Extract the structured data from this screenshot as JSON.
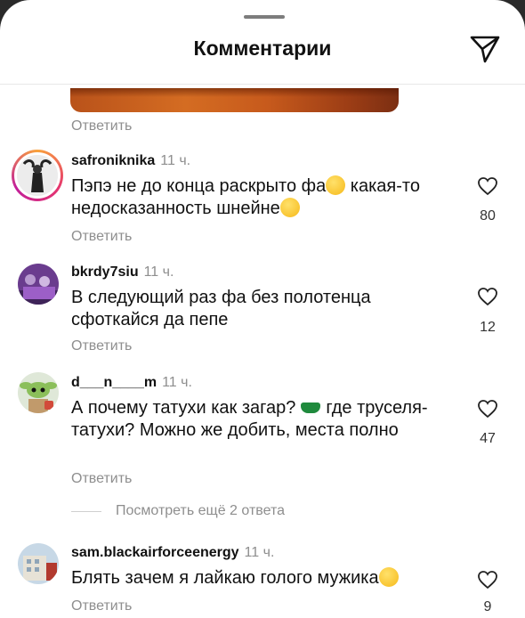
{
  "header": {
    "title": "Комментарии",
    "share_icon": "send-icon"
  },
  "reply_label": "Ответить",
  "comments": [
    {
      "username": "safroniknika",
      "time": "11 ч.",
      "text_a": "Пэпэ не до конца раскрыто фа",
      "text_b": " какая-то недосказанность шнейне",
      "likes": "80"
    },
    {
      "username": "bkrdy7siu",
      "time": "11 ч.",
      "text": "В следующий раз фа без полотенца сфоткайся да пепе",
      "likes": "12"
    },
    {
      "username": "d___n____m",
      "time": "11 ч.",
      "text_a": "А почему татухи как загар?",
      "text_b": "где труселя- татухи? Можно же добить, места полно",
      "likes": "47"
    },
    {
      "username": "sam.blackairforceenergy",
      "time": "11 ч.",
      "text": "Блять зачем я лайкаю голого мужика",
      "likes": "9"
    }
  ],
  "more_replies": "Посмотреть ещё 2 ответа"
}
